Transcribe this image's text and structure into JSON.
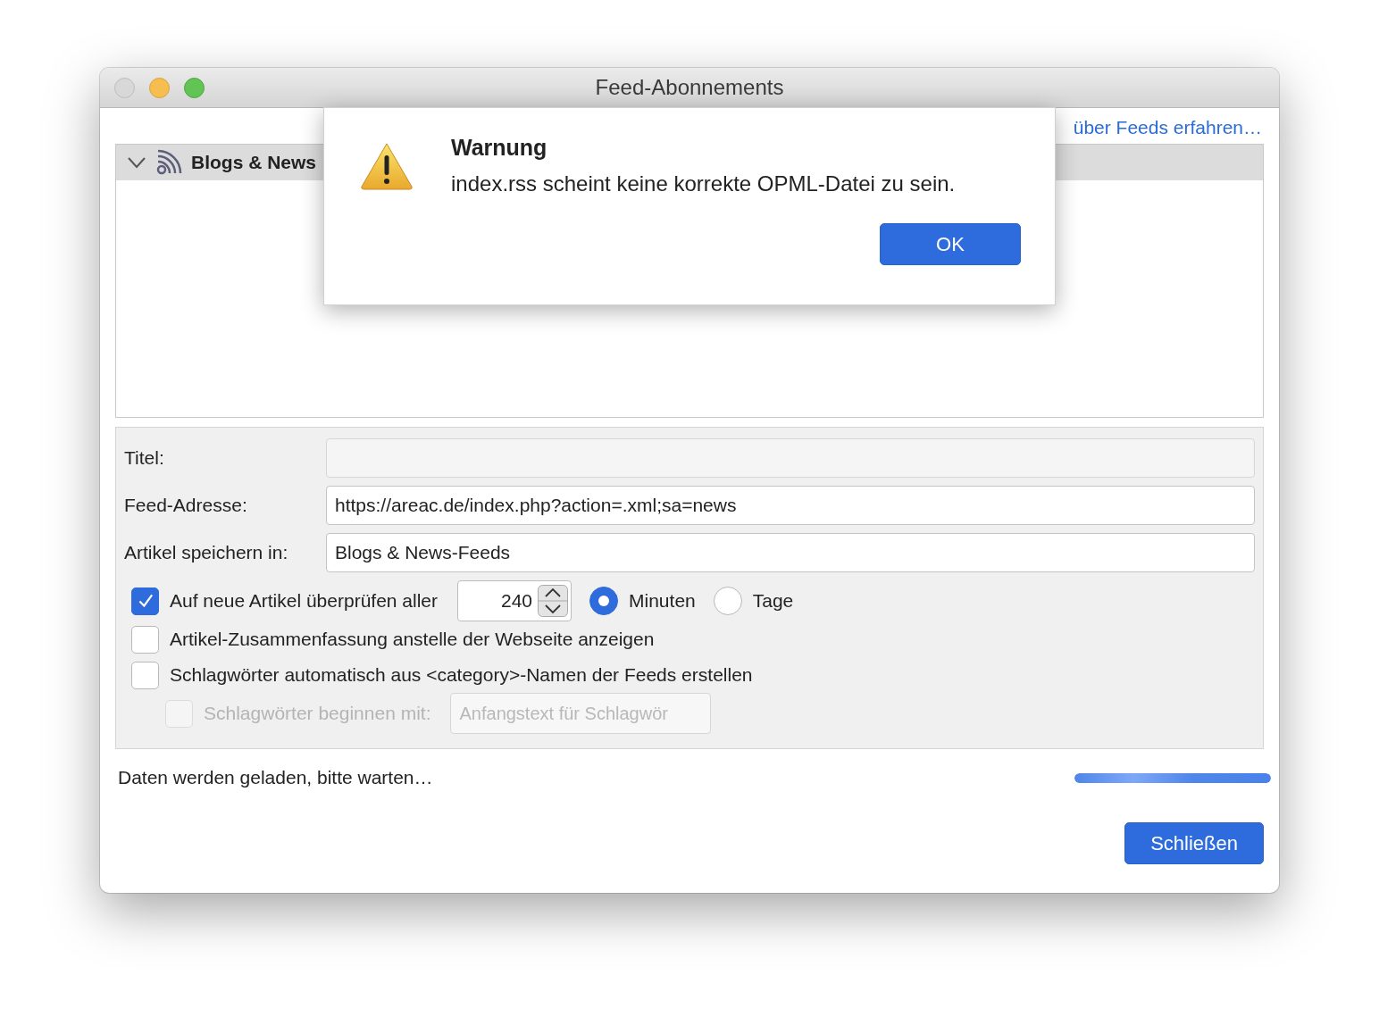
{
  "window": {
    "title": "Feed-Abonnements"
  },
  "header_link": "über Feeds erfahren…",
  "tree": {
    "items": [
      {
        "label": "Blogs & News",
        "expanded": true
      }
    ]
  },
  "form": {
    "fields": [
      {
        "label": "Titel:",
        "disabled": true
      },
      {
        "label": "Feed-Adresse:",
        "value": "https://areac.de/index.php?action=.xml;sa=news",
        "disabled": false
      },
      {
        "label": "Artikel speichern in:",
        "value": "Blogs & News-Feeds",
        "disabled": false
      }
    ],
    "check_interval": {
      "label": "Auf neue Artikel überprüfen aller",
      "checked": true,
      "value": "240",
      "units": [
        {
          "label": "Minuten",
          "selected": true
        },
        {
          "label": "Tage",
          "selected": false
        }
      ]
    },
    "options": [
      {
        "label": "Artikel-Zusammenfassung anstelle der Webseite anzeigen",
        "checked": false
      },
      {
        "label": "Schlagwörter automatisch aus <category>-Namen der Feeds erstellen",
        "checked": false
      }
    ],
    "tag_prefix": {
      "label": "Schlagwörter beginnen mit:",
      "placeholder": "Anfangstext für Schlagwör",
      "checked": false,
      "disabled": true
    }
  },
  "status": {
    "text": "Daten werden geladen, bitte warten…",
    "level": 1
  },
  "buttons": [
    {
      "label": "Schließen"
    }
  ],
  "dialog": {
    "title": "Warnung",
    "message": "index.rss scheint keine korrekte OPML-Datei zu sein.",
    "button": "OK"
  }
}
